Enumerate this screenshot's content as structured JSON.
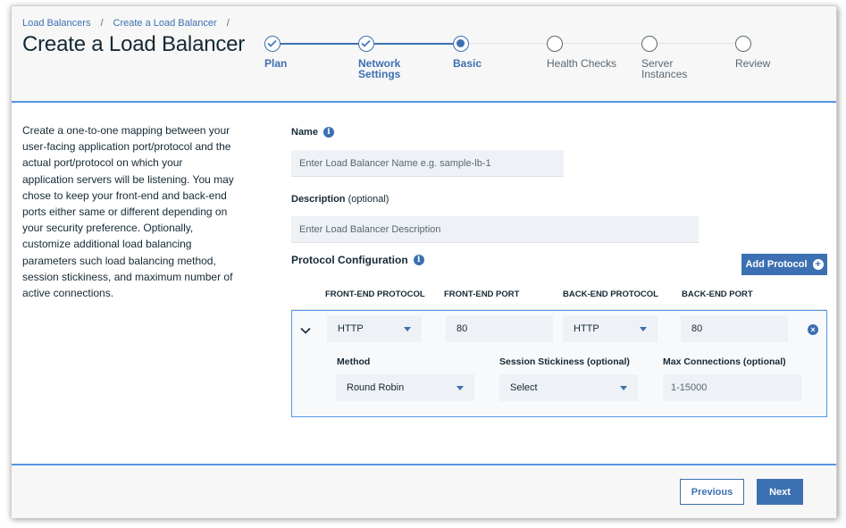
{
  "breadcrumb": {
    "items": [
      "Load Balancers",
      "Create a Load Balancer"
    ],
    "separator": "/"
  },
  "page": {
    "title": "Create a Load Balancer"
  },
  "stepper": {
    "steps": [
      {
        "label": "Plan",
        "state": "done"
      },
      {
        "label": "Network Settings",
        "state": "done"
      },
      {
        "label": "Basic",
        "state": "current"
      },
      {
        "label": "Health Checks",
        "state": "pending"
      },
      {
        "label": "Server Instances",
        "state": "pending"
      },
      {
        "label": "Review",
        "state": "pending"
      }
    ]
  },
  "intro": {
    "text": "Create a one-to-one mapping between your user-facing application port/protocol and the actual port/protocol on which your application servers will be listening. You may chose to keep your front-end and back-end ports either same or different depending on your security preference. Optionally, customize additional load balancing parameters such load balancing method, session stickiness, and maximum number of active connections."
  },
  "form": {
    "name": {
      "label": "Name",
      "placeholder": "Enter Load Balancer Name e.g. sample-lb-1",
      "value": ""
    },
    "description": {
      "label": "Description",
      "optional": "(optional)",
      "placeholder": "Enter Load Balancer Description",
      "value": ""
    },
    "protocol_config": {
      "label": "Protocol Configuration"
    },
    "add_protocol_label": "Add Protocol"
  },
  "protocol_table": {
    "headers": [
      "FRONT-END PROTOCOL",
      "FRONT-END PORT",
      "BACK-END PROTOCOL",
      "BACK-END PORT"
    ],
    "row": {
      "frontend_protocol": "HTTP",
      "frontend_port": "80",
      "backend_protocol": "HTTP",
      "backend_port": "80",
      "method_label": "Method",
      "method_value": "Round Robin",
      "stickiness_label": "Session Stickiness (optional)",
      "stickiness_value": "Select",
      "max_conn_label": "Max Connections (optional)",
      "max_conn_placeholder": "1-15000"
    }
  },
  "footer": {
    "previous_label": "Previous",
    "next_label": "Next"
  },
  "colors": {
    "accent": "#3d70b2",
    "divider": "#5596e6",
    "field_bg": "#eef1f5",
    "highlight": "#f6f29c"
  }
}
